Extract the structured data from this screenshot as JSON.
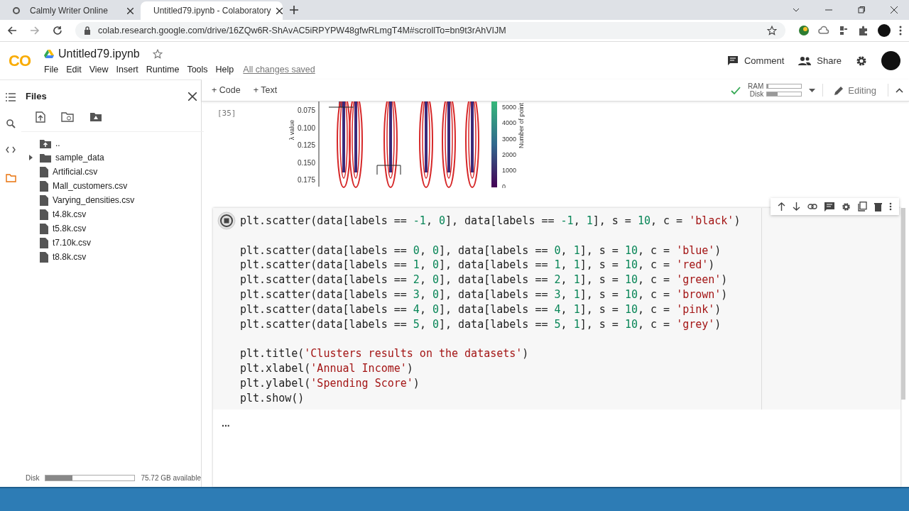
{
  "browser": {
    "tabs": [
      {
        "title": "Calmly Writer Online",
        "selected": false
      },
      {
        "title": "Untitled79.ipynb - Colaboratory",
        "selected": true
      }
    ],
    "url": "colab.research.google.com/drive/16ZQw6R-ShAvAC5iRPYPW48gfwRLmgT4M#scrollTo=bn9t3rAhVIJM"
  },
  "header": {
    "logo": "CO",
    "title": "Untitled79.ipynb",
    "menu": [
      "File",
      "Edit",
      "View",
      "Insert",
      "Runtime",
      "Tools",
      "Help"
    ],
    "save_status": "All changes saved",
    "comment": "Comment",
    "share": "Share"
  },
  "toolbar": {
    "add_code": "+ Code",
    "add_text": "+ Text",
    "ram": {
      "label": "RAM",
      "level": 0.04
    },
    "disk": {
      "label": "Disk",
      "level": 0.3
    },
    "mode": "Editing"
  },
  "sidebar": {
    "title": "Files",
    "items": [
      {
        "name": "..",
        "kind": "parent"
      },
      {
        "name": "sample_data",
        "kind": "folder",
        "expanded": false
      },
      {
        "name": "Artificial.csv",
        "kind": "file"
      },
      {
        "name": "Mall_customers.csv",
        "kind": "file"
      },
      {
        "name": "Varying_densities.csv",
        "kind": "file"
      },
      {
        "name": "t4.8k.csv",
        "kind": "file"
      },
      {
        "name": "t5.8k.csv",
        "kind": "file"
      },
      {
        "name": "t7.10k.csv",
        "kind": "file"
      },
      {
        "name": "t8.8k.csv",
        "kind": "file"
      }
    ],
    "disk": {
      "label": "Disk",
      "level": 0.3,
      "available": "75.72 GB available"
    }
  },
  "previous_output": {
    "exec_count": "[35]",
    "ylabel": "λ value",
    "yticks": [
      "0.075",
      "0.100",
      "0.125",
      "0.150",
      "0.175"
    ],
    "colorbar_label": "Number of point",
    "colorbar_ticks": [
      "5000",
      "4000",
      "3000",
      "2000",
      "1000",
      "0"
    ]
  },
  "cell": {
    "running": true,
    "output": "...",
    "blocks": [
      [
        [
          {
            "t": "plt.scatter(data[labels == ",
            "kind": "plain"
          },
          {
            "t": "-1",
            "kind": "num"
          },
          {
            "t": ", ",
            "kind": "plain"
          },
          {
            "t": "0",
            "kind": "num"
          },
          {
            "t": "], data[labels == ",
            "kind": "plain"
          },
          {
            "t": "-1",
            "kind": "num"
          },
          {
            "t": ", ",
            "kind": "plain"
          },
          {
            "t": "1",
            "kind": "num"
          },
          {
            "t": "], s = ",
            "kind": "plain"
          },
          {
            "t": "10",
            "kind": "num"
          },
          {
            "t": ", c = ",
            "kind": "plain"
          },
          {
            "t": "'black'",
            "kind": "str"
          },
          {
            "t": ")",
            "kind": "plain"
          }
        ]
      ],
      [
        [
          {
            "t": "plt.scatter(data[labels == ",
            "kind": "plain"
          },
          {
            "t": "0",
            "kind": "num"
          },
          {
            "t": ", ",
            "kind": "plain"
          },
          {
            "t": "0",
            "kind": "num"
          },
          {
            "t": "], data[labels == ",
            "kind": "plain"
          },
          {
            "t": "0",
            "kind": "num"
          },
          {
            "t": ", ",
            "kind": "plain"
          },
          {
            "t": "1",
            "kind": "num"
          },
          {
            "t": "], s = ",
            "kind": "plain"
          },
          {
            "t": "10",
            "kind": "num"
          },
          {
            "t": ", c = ",
            "kind": "plain"
          },
          {
            "t": "'blue'",
            "kind": "str"
          },
          {
            "t": ")",
            "kind": "plain"
          }
        ],
        [
          {
            "t": "plt.scatter(data[labels == ",
            "kind": "plain"
          },
          {
            "t": "1",
            "kind": "num"
          },
          {
            "t": ", ",
            "kind": "plain"
          },
          {
            "t": "0",
            "kind": "num"
          },
          {
            "t": "], data[labels == ",
            "kind": "plain"
          },
          {
            "t": "1",
            "kind": "num"
          },
          {
            "t": ", ",
            "kind": "plain"
          },
          {
            "t": "1",
            "kind": "num"
          },
          {
            "t": "], s = ",
            "kind": "plain"
          },
          {
            "t": "10",
            "kind": "num"
          },
          {
            "t": ", c = ",
            "kind": "plain"
          },
          {
            "t": "'red'",
            "kind": "str"
          },
          {
            "t": ")",
            "kind": "plain"
          }
        ],
        [
          {
            "t": "plt.scatter(data[labels == ",
            "kind": "plain"
          },
          {
            "t": "2",
            "kind": "num"
          },
          {
            "t": ", ",
            "kind": "plain"
          },
          {
            "t": "0",
            "kind": "num"
          },
          {
            "t": "], data[labels == ",
            "kind": "plain"
          },
          {
            "t": "2",
            "kind": "num"
          },
          {
            "t": ", ",
            "kind": "plain"
          },
          {
            "t": "1",
            "kind": "num"
          },
          {
            "t": "], s = ",
            "kind": "plain"
          },
          {
            "t": "10",
            "kind": "num"
          },
          {
            "t": ", c = ",
            "kind": "plain"
          },
          {
            "t": "'green'",
            "kind": "str"
          },
          {
            "t": ")",
            "kind": "plain"
          }
        ],
        [
          {
            "t": "plt.scatter(data[labels == ",
            "kind": "plain"
          },
          {
            "t": "3",
            "kind": "num"
          },
          {
            "t": ", ",
            "kind": "plain"
          },
          {
            "t": "0",
            "kind": "num"
          },
          {
            "t": "], data[labels == ",
            "kind": "plain"
          },
          {
            "t": "3",
            "kind": "num"
          },
          {
            "t": ", ",
            "kind": "plain"
          },
          {
            "t": "1",
            "kind": "num"
          },
          {
            "t": "], s = ",
            "kind": "plain"
          },
          {
            "t": "10",
            "kind": "num"
          },
          {
            "t": ", c = ",
            "kind": "plain"
          },
          {
            "t": "'brown'",
            "kind": "str"
          },
          {
            "t": ")",
            "kind": "plain"
          }
        ],
        [
          {
            "t": "plt.scatter(data[labels == ",
            "kind": "plain"
          },
          {
            "t": "4",
            "kind": "num"
          },
          {
            "t": ", ",
            "kind": "plain"
          },
          {
            "t": "0",
            "kind": "num"
          },
          {
            "t": "], data[labels == ",
            "kind": "plain"
          },
          {
            "t": "4",
            "kind": "num"
          },
          {
            "t": ", ",
            "kind": "plain"
          },
          {
            "t": "1",
            "kind": "num"
          },
          {
            "t": "], s = ",
            "kind": "plain"
          },
          {
            "t": "10",
            "kind": "num"
          },
          {
            "t": ", c = ",
            "kind": "plain"
          },
          {
            "t": "'pink'",
            "kind": "str"
          },
          {
            "t": ")",
            "kind": "plain"
          }
        ],
        [
          {
            "t": "plt.scatter(data[labels == ",
            "kind": "plain"
          },
          {
            "t": "5",
            "kind": "num"
          },
          {
            "t": ", ",
            "kind": "plain"
          },
          {
            "t": "0",
            "kind": "num"
          },
          {
            "t": "], data[labels == ",
            "kind": "plain"
          },
          {
            "t": "5",
            "kind": "num"
          },
          {
            "t": ", ",
            "kind": "plain"
          },
          {
            "t": "1",
            "kind": "num"
          },
          {
            "t": "], s = ",
            "kind": "plain"
          },
          {
            "t": "10",
            "kind": "num"
          },
          {
            "t": ", c = ",
            "kind": "plain"
          },
          {
            "t": "'grey'",
            "kind": "str"
          },
          {
            "t": ")",
            "kind": "plain"
          }
        ]
      ],
      [
        [
          {
            "t": "plt.title(",
            "kind": "plain"
          },
          {
            "t": "'Clusters results on the datasets'",
            "kind": "str"
          },
          {
            "t": ")",
            "kind": "plain"
          }
        ],
        [
          {
            "t": "plt.xlabel(",
            "kind": "plain"
          },
          {
            "t": "'Annual Income'",
            "kind": "str"
          },
          {
            "t": ")",
            "kind": "plain"
          }
        ],
        [
          {
            "t": "plt.ylabel(",
            "kind": "plain"
          },
          {
            "t": "'Spending Score'",
            "kind": "str"
          },
          {
            "t": ")",
            "kind": "plain"
          }
        ],
        [
          {
            "t": "plt.show()",
            "kind": "plain"
          }
        ]
      ]
    ]
  }
}
